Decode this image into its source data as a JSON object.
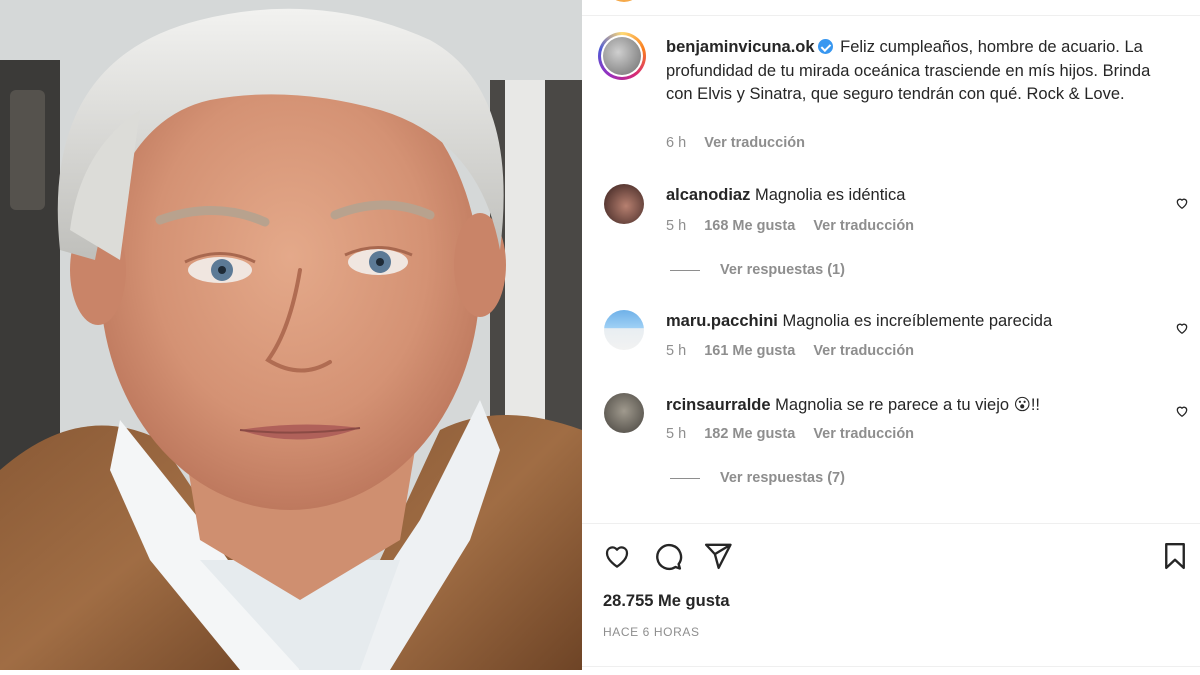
{
  "post": {
    "username": "benjaminvicuna.ok",
    "caption": "Feliz cumpleaños, hombre de acuario. La profundidad de tu mirada oceánica trasciende en mís hijos. Brinda con Elvis y Sinatra, que seguro tendrán con qué. Rock & Love.",
    "time": "6 h",
    "translate": "Ver traducción"
  },
  "comments": [
    {
      "username": "alcanodiaz",
      "text": "Magnolia es idéntica",
      "time": "5 h",
      "likes": "168 Me gusta",
      "translate": "Ver traducción",
      "replies": "Ver respuestas (1)"
    },
    {
      "username": "maru.pacchini",
      "text": "Magnolia es increíblemente parecida",
      "time": "5 h",
      "likes": "161 Me gusta",
      "translate": "Ver traducción"
    },
    {
      "username": "rcinsaurralde",
      "text": "Magnolia se re parece a tu viejo",
      "emoji": "😮",
      "suffix": "!!",
      "time": "5 h",
      "likes": "182 Me gusta",
      "translate": "Ver traducción",
      "replies": "Ver respuestas (7)"
    }
  ],
  "footer": {
    "likes": "28.755 Me gusta",
    "ago": "HACE 6 HORAS"
  },
  "icons": {
    "like": "heart-icon",
    "comment": "comment-icon",
    "share": "send-icon",
    "save": "bookmark-icon",
    "verified": "verified-badge-icon"
  },
  "colors": {
    "verified": "#3897f0",
    "muted_text": "#8e8e8e",
    "text": "#262626"
  }
}
